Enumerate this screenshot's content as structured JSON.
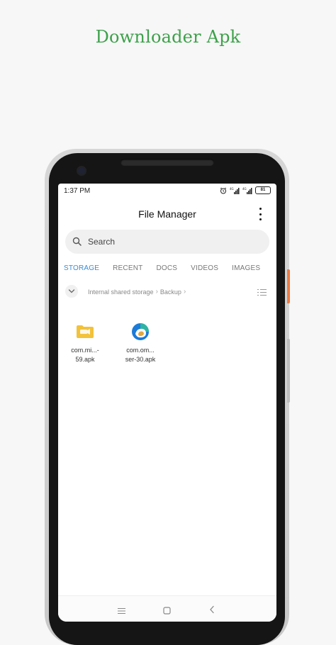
{
  "promo": {
    "title": "Downloader Apk"
  },
  "status_bar": {
    "time": "1:37 PM",
    "battery": "81",
    "icons": [
      "alarm-icon",
      "signal-icon-1",
      "signal-icon-2",
      "battery-icon"
    ]
  },
  "app": {
    "title": "File Manager",
    "more_icon": "more-vertical-icon"
  },
  "search": {
    "placeholder": "Search"
  },
  "tabs": [
    {
      "label": "STORAGE",
      "active": true
    },
    {
      "label": "RECENT",
      "active": false
    },
    {
      "label": "DOCS",
      "active": false
    },
    {
      "label": "VIDEOS",
      "active": false
    },
    {
      "label": "IMAGES",
      "active": false
    }
  ],
  "breadcrumb": {
    "items": [
      "Internal shared storage",
      "Backup"
    ]
  },
  "files": [
    {
      "name_line1": "com.mi...-",
      "name_line2": "59.apk",
      "icon": "video-folder-icon"
    },
    {
      "name_line1": "com.om...",
      "name_line2": "ser-30.apk",
      "icon": "edge-browser-icon"
    }
  ],
  "nav": {
    "icons": [
      "menu-icon",
      "home-icon",
      "back-icon"
    ]
  },
  "colors": {
    "promo_title": "#3da14a",
    "active_tab": "#3a8bd6",
    "video_icon": "#f2c23a"
  }
}
